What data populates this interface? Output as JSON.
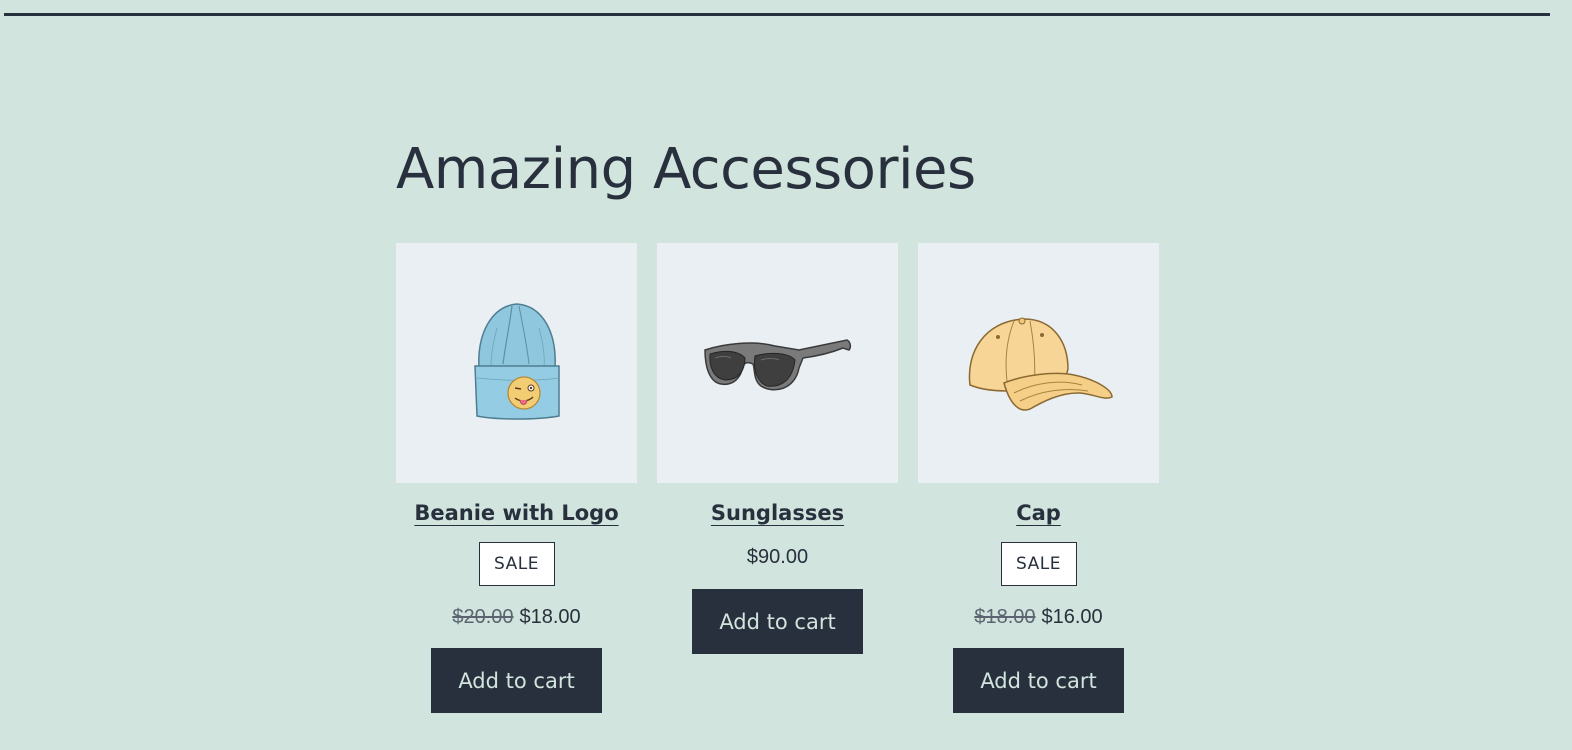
{
  "section": {
    "title": "Amazing Accessories"
  },
  "products": [
    {
      "name": "Beanie with Logo",
      "badge": "SALE",
      "price_old": "$20.00",
      "price_new": "$18.00",
      "button": "Add to cart",
      "image_icon": "beanie-image"
    },
    {
      "name": "Sunglasses",
      "price": "$90.00",
      "button": "Add to cart",
      "image_icon": "sunglasses-image"
    },
    {
      "name": "Cap",
      "badge": "SALE",
      "price_old": "$18.00",
      "price_new": "$16.00",
      "button": "Add to cart",
      "image_icon": "cap-image"
    }
  ],
  "colors": {
    "background": "#d1e4dd",
    "text": "#28303d",
    "thumb_bg": "#e9eff3",
    "button_bg": "#28303d",
    "button_text": "#d1e4dd"
  }
}
